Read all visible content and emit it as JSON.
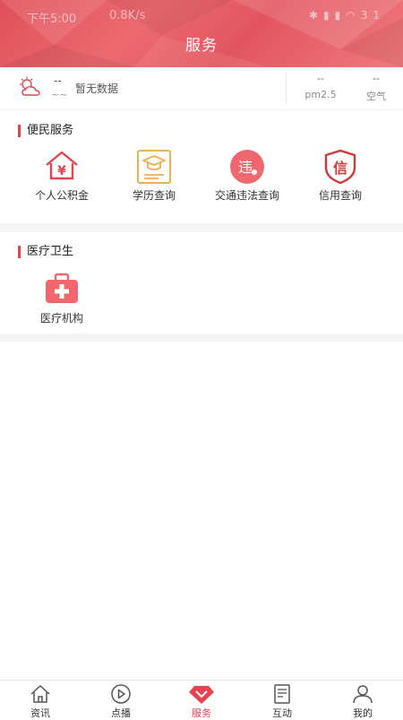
{
  "status_bar": {
    "time": "下午5:00",
    "network_speed": "0.8K/s",
    "battery": "31"
  },
  "header": {
    "title": "服务"
  },
  "weather": {
    "temperature": "--",
    "condition_placeholder": "~~",
    "description": "暂无数据",
    "pm25": {
      "value": "--",
      "label": "pm2.5"
    },
    "air": {
      "value": "--",
      "label": "空气"
    }
  },
  "sections": [
    {
      "title": "便民服务",
      "items": [
        {
          "label": "个人公积金",
          "icon": "housing-fund-icon"
        },
        {
          "label": "学历查询",
          "icon": "education-icon"
        },
        {
          "label": "交通违法查询",
          "icon": "traffic-violation-icon",
          "glyph": "违"
        },
        {
          "label": "信用查询",
          "icon": "credit-icon",
          "glyph": "信"
        }
      ]
    },
    {
      "title": "医疗卫生",
      "items": [
        {
          "label": "医疗机构",
          "icon": "medical-kit-icon"
        }
      ]
    }
  ],
  "tabbar": {
    "active": "服务",
    "tabs": [
      {
        "label": "资讯",
        "icon": "home-icon"
      },
      {
        "label": "点播",
        "icon": "play-icon"
      },
      {
        "label": "服务",
        "icon": "service-diamond-icon"
      },
      {
        "label": "互动",
        "icon": "news-icon"
      },
      {
        "label": "我的",
        "icon": "user-icon"
      }
    ]
  },
  "colors": {
    "accent": "#e4444f",
    "header_light": "#f07a7e",
    "gap": "#f4f4f4"
  }
}
